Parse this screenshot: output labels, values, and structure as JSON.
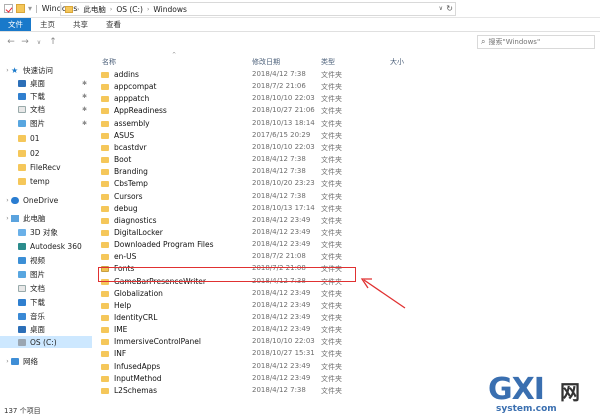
{
  "window": {
    "title": "Windows"
  },
  "ribbon": {
    "tabs": [
      "文件",
      "主页",
      "共享",
      "查看"
    ]
  },
  "address": {
    "crumbs": [
      "此电脑",
      "OS (C:)",
      "Windows"
    ],
    "search_placeholder": "搜索\"Windows\""
  },
  "navpane": {
    "items": [
      {
        "label": "快速访问",
        "icon": "star-icon",
        "kind": "header"
      },
      {
        "label": "桌面",
        "icon": "desktop-icon",
        "pinned": true
      },
      {
        "label": "下载",
        "icon": "download-icon",
        "pinned": true
      },
      {
        "label": "文档",
        "icon": "document-icon",
        "pinned": true
      },
      {
        "label": "图片",
        "icon": "picture-icon",
        "pinned": true
      },
      {
        "label": "01",
        "icon": "folder-icon"
      },
      {
        "label": "02",
        "icon": "folder-icon"
      },
      {
        "label": "FileRecv",
        "icon": "folder-icon"
      },
      {
        "label": "temp",
        "icon": "folder-icon"
      },
      {
        "label": "OneDrive",
        "icon": "cloud-icon",
        "kind": "header"
      },
      {
        "label": "此电脑",
        "icon": "computer-icon",
        "kind": "header"
      },
      {
        "label": "3D 对象",
        "icon": "3d-objects-icon"
      },
      {
        "label": "Autodesk 360",
        "icon": "autodesk-icon"
      },
      {
        "label": "视频",
        "icon": "video-icon"
      },
      {
        "label": "图片",
        "icon": "picture-icon"
      },
      {
        "label": "文档",
        "icon": "document-icon"
      },
      {
        "label": "下载",
        "icon": "download-icon"
      },
      {
        "label": "音乐",
        "icon": "music-icon"
      },
      {
        "label": "桌面",
        "icon": "desktop-icon"
      },
      {
        "label": "OS (C:)",
        "icon": "drive-icon",
        "selected": true
      },
      {
        "label": "网络",
        "icon": "network-icon",
        "kind": "header"
      }
    ]
  },
  "columns": {
    "name": "名称",
    "date": "修改日期",
    "type": "类型",
    "size": "大小"
  },
  "files": [
    {
      "name": "addins",
      "date": "2018/4/12 7:38",
      "type": "文件夹"
    },
    {
      "name": "appcompat",
      "date": "2018/7/2 21:06",
      "type": "文件夹"
    },
    {
      "name": "apppatch",
      "date": "2018/10/10 22:03",
      "type": "文件夹"
    },
    {
      "name": "AppReadiness",
      "date": "2018/10/27 21:06",
      "type": "文件夹"
    },
    {
      "name": "assembly",
      "date": "2018/10/13 18:14",
      "type": "文件夹"
    },
    {
      "name": "ASUS",
      "date": "2017/6/15 20:29",
      "type": "文件夹"
    },
    {
      "name": "bcastdvr",
      "date": "2018/10/10 22:03",
      "type": "文件夹"
    },
    {
      "name": "Boot",
      "date": "2018/4/12 7:38",
      "type": "文件夹"
    },
    {
      "name": "Branding",
      "date": "2018/4/12 7:38",
      "type": "文件夹"
    },
    {
      "name": "CbsTemp",
      "date": "2018/10/20 23:23",
      "type": "文件夹"
    },
    {
      "name": "Cursors",
      "date": "2018/4/12 7:38",
      "type": "文件夹"
    },
    {
      "name": "debug",
      "date": "2018/10/13 17:14",
      "type": "文件夹"
    },
    {
      "name": "diagnostics",
      "date": "2018/4/12 23:49",
      "type": "文件夹"
    },
    {
      "name": "DigitalLocker",
      "date": "2018/4/12 23:49",
      "type": "文件夹"
    },
    {
      "name": "Downloaded Program Files",
      "date": "2018/4/12 23:49",
      "type": "文件夹"
    },
    {
      "name": "en-US",
      "date": "2018/7/2 21:08",
      "type": "文件夹"
    },
    {
      "name": "Fonts",
      "date": "2018/7/2 21:08",
      "type": "文件夹",
      "highlighted": true
    },
    {
      "name": "GameBarPresenceWriter",
      "date": "2018/4/12 7:38",
      "type": "文件夹"
    },
    {
      "name": "Globalization",
      "date": "2018/4/12 23:49",
      "type": "文件夹"
    },
    {
      "name": "Help",
      "date": "2018/4/12 23:49",
      "type": "文件夹"
    },
    {
      "name": "IdentityCRL",
      "date": "2018/4/12 23:49",
      "type": "文件夹"
    },
    {
      "name": "IME",
      "date": "2018/4/12 23:49",
      "type": "文件夹"
    },
    {
      "name": "ImmersiveControlPanel",
      "date": "2018/10/10 22:03",
      "type": "文件夹"
    },
    {
      "name": "INF",
      "date": "2018/10/27 15:31",
      "type": "文件夹"
    },
    {
      "name": "InfusedApps",
      "date": "2018/4/12 23:49",
      "type": "文件夹"
    },
    {
      "name": "InputMethod",
      "date": "2018/4/12 23:49",
      "type": "文件夹"
    },
    {
      "name": "L2Schemas",
      "date": "2018/4/12 7:38",
      "type": "文件夹"
    }
  ],
  "status": {
    "item_count": "137 个项目"
  },
  "watermark": {
    "brand": "GXI",
    "cn": "网",
    "domain": "system.com"
  },
  "colors": {
    "accent": "#1979ca",
    "highlight_box": "#e03131",
    "selection": "#cde8ff"
  }
}
